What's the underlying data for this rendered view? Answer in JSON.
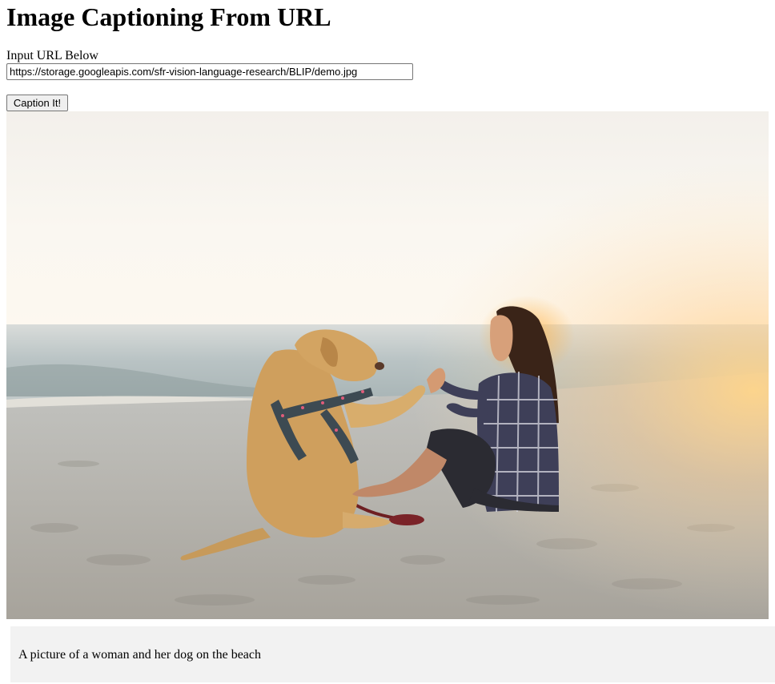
{
  "page": {
    "title": "Image Captioning From URL"
  },
  "form": {
    "url_label": "Input URL Below",
    "url_value": "https://storage.googleapis.com/sfr-vision-language-research/BLIP/demo.jpg",
    "submit_label": "Caption It!"
  },
  "result": {
    "caption": "A picture of a woman and her dog on the beach"
  },
  "colors": {
    "caption_background": "#f2f2f2",
    "button_background": "#efefef",
    "input_border": "#767676"
  }
}
